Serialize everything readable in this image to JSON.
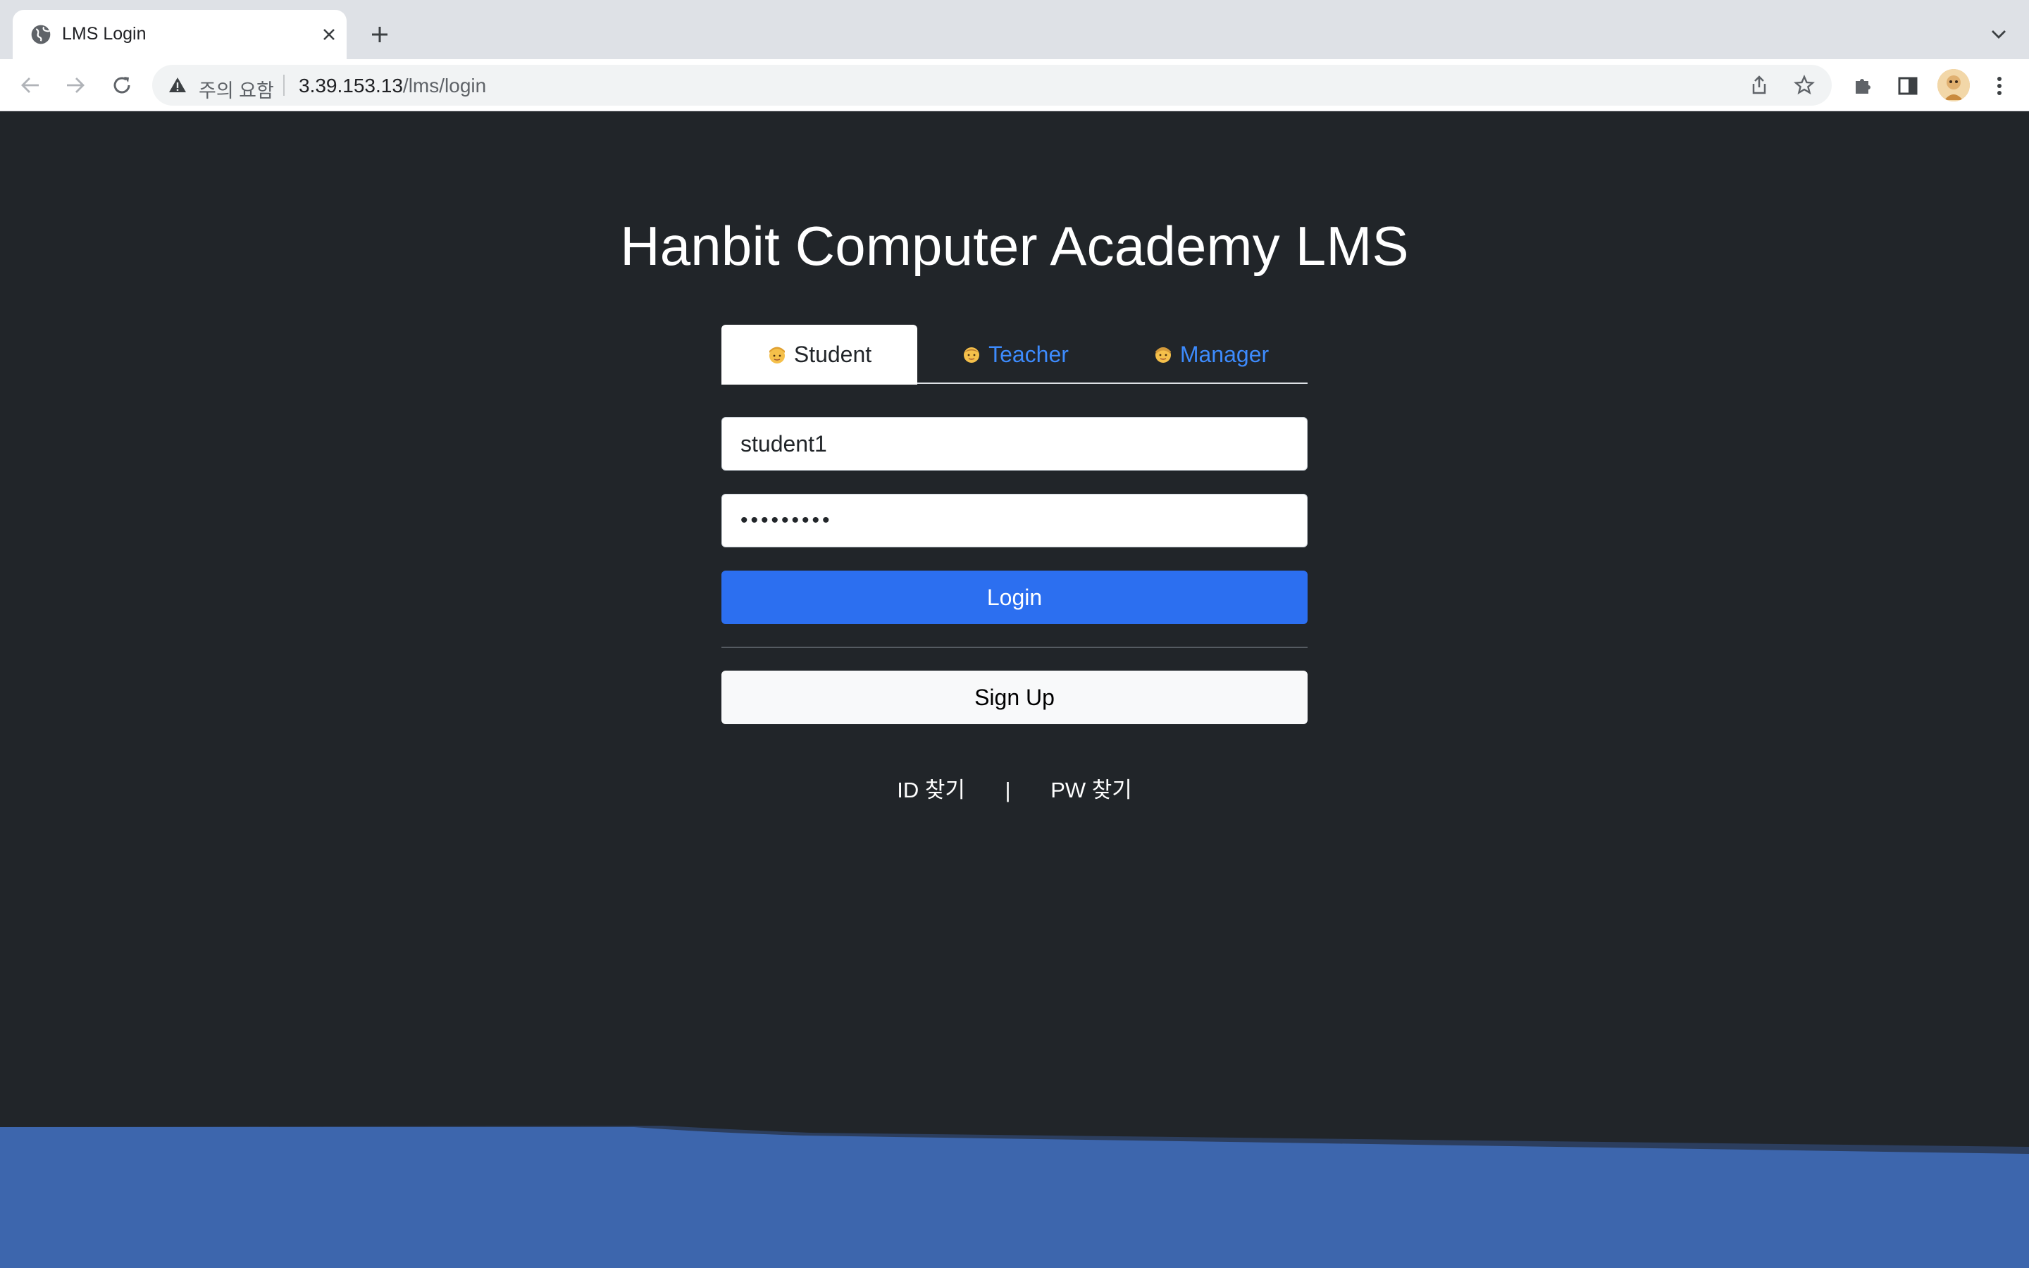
{
  "browser": {
    "tab_title": "LMS Login",
    "security_warning": "주의 요함",
    "url_host": "3.39.153.13",
    "url_path": "/lms/login"
  },
  "page": {
    "heading": "Hanbit Computer Academy LMS",
    "role_tabs": [
      {
        "label": "Student",
        "active": true
      },
      {
        "label": "Teacher",
        "active": false
      },
      {
        "label": "Manager",
        "active": false
      }
    ],
    "username_value": "student1",
    "password_masked": "•••••••••",
    "login_label": "Login",
    "signup_label": "Sign Up",
    "find_id_label": "ID 찾기",
    "link_separator": "|",
    "find_pw_label": "PW 찾기"
  },
  "colors": {
    "page_background": "#212529",
    "primary_button": "#2c6ff0",
    "tab_link": "#3d8bfd",
    "wave": "#3d66ad"
  }
}
